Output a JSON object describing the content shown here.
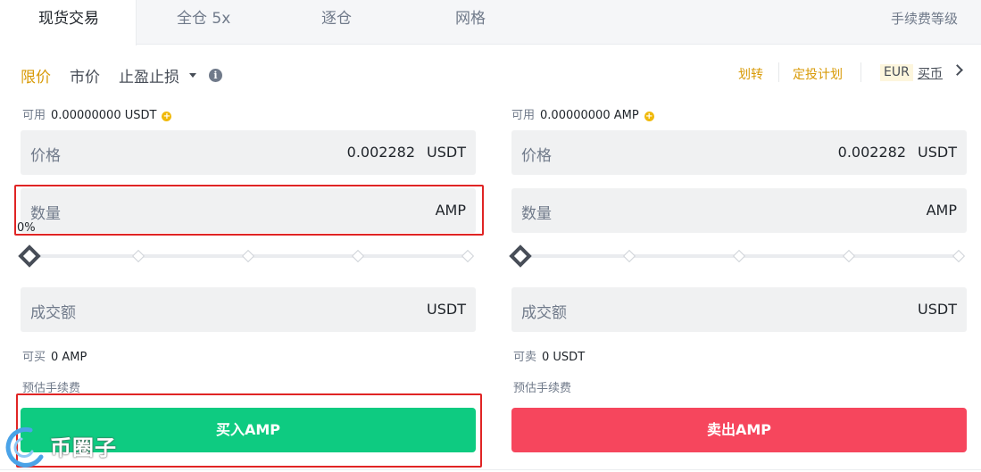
{
  "tabs": [
    {
      "label": "现货交易",
      "active": true
    },
    {
      "label": "全仓 5x",
      "active": false
    },
    {
      "label": "逐仓",
      "active": false
    },
    {
      "label": "网格",
      "active": false
    }
  ],
  "fee_level": "手续费等级",
  "order_types": [
    "限价",
    "市价",
    "止盈止损"
  ],
  "header_links": {
    "transfer": "划转",
    "auto_invest": "定投计划",
    "currency": "EUR",
    "buy_crypto": "买币"
  },
  "buy": {
    "available_label": "可用",
    "available_value": "0.00000000 USDT",
    "price_label": "价格",
    "price_value": "0.002282",
    "price_unit": "USDT",
    "amount_label": "数量",
    "amount_unit": "AMP",
    "slider_percent": "0%",
    "total_label": "成交额",
    "total_unit": "USDT",
    "max_label": "可买",
    "max_value": "0 AMP",
    "fee_label": "预估手续费",
    "button_label": "买入AMP",
    "slider_level": 0
  },
  "sell": {
    "available_label": "可用",
    "available_value": "0.00000000 AMP",
    "price_label": "价格",
    "price_value": "0.002282",
    "price_unit": "USDT",
    "amount_label": "数量",
    "amount_unit": "AMP",
    "total_label": "成交额",
    "total_unit": "USDT",
    "max_label": "可卖",
    "max_value": "0 USDT",
    "fee_label": "预估手续费",
    "button_label": "卖出AMP",
    "slider_level": 0
  },
  "watermark": {
    "text": "币圈子"
  },
  "colors": {
    "accent": "#d89a06",
    "buy": "#0ecb81",
    "sell": "#f6465d",
    "highlight": "#e02424"
  }
}
